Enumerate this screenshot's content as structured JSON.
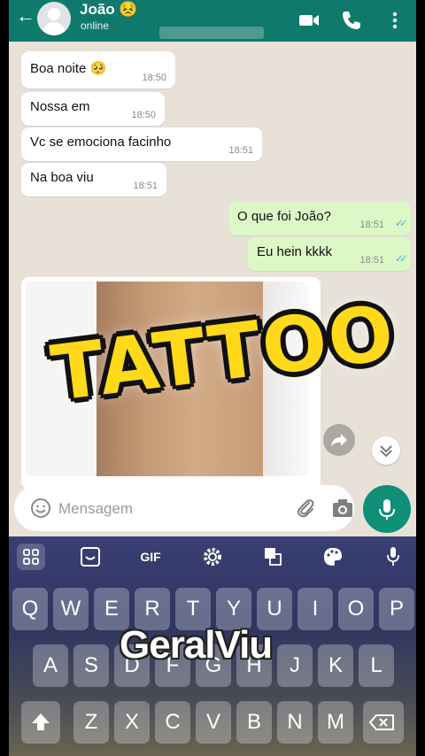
{
  "header": {
    "back_icon": "arrow-left-icon",
    "contact_name": "João 😣",
    "status": "online",
    "icons": [
      "video-call-icon",
      "phone-icon",
      "more-vert-icon"
    ]
  },
  "messages": [
    {
      "dir": "in",
      "text": "Boa noite 🥺",
      "time": "18:50"
    },
    {
      "dir": "in",
      "text": "Nossa em",
      "time": "18:50"
    },
    {
      "dir": "in",
      "text": "Vc se emociona facinho",
      "time": "18:51"
    },
    {
      "dir": "in",
      "text": "Na boa viu",
      "time": "18:51"
    },
    {
      "dir": "out",
      "text": "O que foi João?",
      "time": "18:51",
      "read": true
    },
    {
      "dir": "out",
      "text": "Eu hein kkkk",
      "time": "18:51",
      "read": true
    }
  ],
  "overlay": {
    "tattoo_text": "TATTOO",
    "watermark": "GeralViu"
  },
  "composer": {
    "placeholder": "Mensagem"
  },
  "keyboard": {
    "toolbar": [
      "apps-icon",
      "sticker-icon",
      "GIF",
      "settings-icon",
      "translate-icon",
      "palette-icon",
      "mic-icon"
    ],
    "row1": [
      "Q",
      "W",
      "E",
      "R",
      "T",
      "Y",
      "U",
      "I",
      "O",
      "P"
    ],
    "row2": [
      "A",
      "S",
      "D",
      "F",
      "G",
      "H",
      "J",
      "K",
      "L"
    ],
    "row3": [
      "Z",
      "X",
      "C",
      "V",
      "B",
      "N",
      "M"
    ]
  },
  "colors": {
    "header": "#0f7a6b",
    "outgoing_bubble": "#dcf8c6",
    "incoming_bubble": "#ffffff",
    "read_ticks": "#4fb6ec",
    "tattoo_text": "#ffd91a"
  }
}
